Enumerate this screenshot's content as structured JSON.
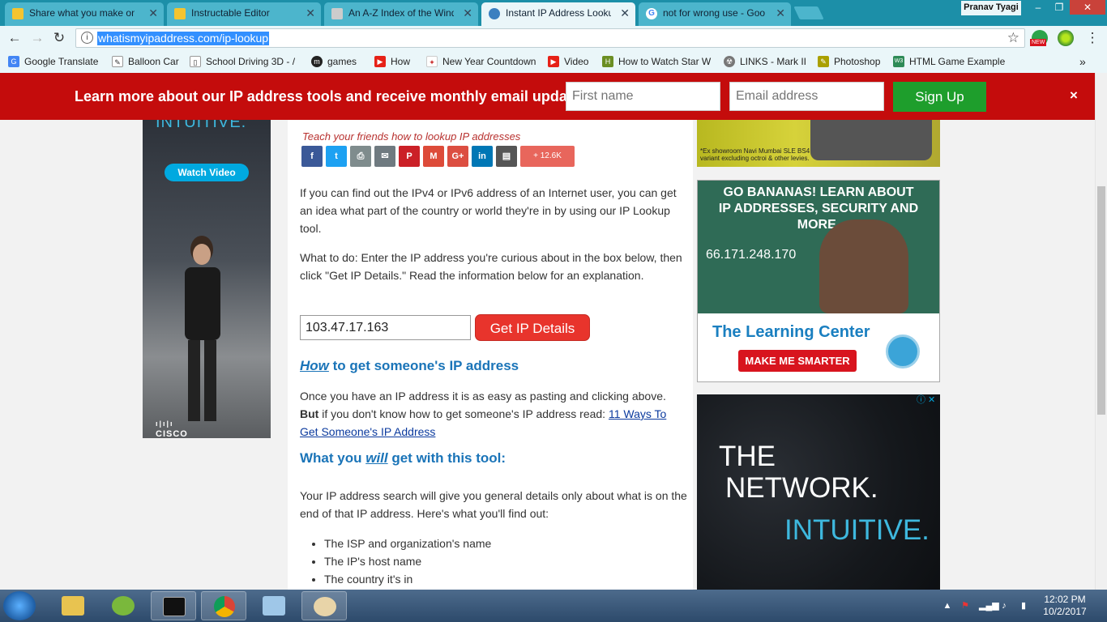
{
  "tabs": [
    {
      "label": "Share what you make on",
      "icon": "instructables-icon",
      "color": "#f4c430"
    },
    {
      "label": "Instructable Editor",
      "icon": "instructables-icon",
      "color": "#f4c430"
    },
    {
      "label": "An A-Z Index of the Wind",
      "icon": "page-icon",
      "color": "#cccccc"
    },
    {
      "label": "Instant IP Address Looku",
      "icon": "globe-icon",
      "color": "#3a7fc0"
    },
    {
      "label": "not for wrong use - Goo",
      "icon": "google-icon",
      "color": "#4285f4"
    }
  ],
  "user": "Pranav Tyagi",
  "window_controls": {
    "minimize": "–",
    "maximize": "❐",
    "close": "✕"
  },
  "address": {
    "url": "whatismyipaddress.com/ip-lookup"
  },
  "extension_badge": "NEW",
  "bookmarks": [
    {
      "label": "Google Translate",
      "color": "#4285f4",
      "glyph": "G"
    },
    {
      "label": "Balloon Car",
      "color": "#ffffff",
      "glyph": "✎"
    },
    {
      "label": "School Driving 3D - /",
      "color": "#ffffff",
      "glyph": "▯"
    },
    {
      "label": "games",
      "color": "#222222",
      "glyph": "m"
    },
    {
      "label": "How",
      "color": "#e62117",
      "glyph": "▶"
    },
    {
      "label": "New Year Countdown",
      "color": "#ffffff",
      "glyph": "✦"
    },
    {
      "label": "Video",
      "color": "#e62117",
      "glyph": "▶"
    },
    {
      "label": "How to Watch Star W",
      "color": "#6b8e23",
      "glyph": "H"
    },
    {
      "label": "LINKS - Mark II",
      "color": "#777777",
      "glyph": "☢"
    },
    {
      "label": "Photoshop",
      "color": "#aaa000",
      "glyph": "✎"
    },
    {
      "label": "HTML Game Example",
      "color": "#2e8b57",
      "glyph": "W3"
    }
  ],
  "bookmarks_more": "»",
  "banner": {
    "message": "Learn more about our IP address tools and receive monthly email updates",
    "first_name_placeholder": "First name",
    "email_placeholder": "Email address",
    "signup": "Sign Up",
    "close": "×"
  },
  "left_ad": {
    "tagline": "INTUITIVE.",
    "cta": "Watch Video",
    "brand": "CISCO"
  },
  "main": {
    "teach": "Teach your friends how to lookup IP addresses",
    "share_buttons": [
      {
        "name": "facebook",
        "glyph": "f",
        "color": "#3b5998"
      },
      {
        "name": "twitter",
        "glyph": "t",
        "color": "#1da1f2"
      },
      {
        "name": "print",
        "glyph": "⎙",
        "color": "#7f8c8d"
      },
      {
        "name": "email",
        "glyph": "✉",
        "color": "#6f7a80"
      },
      {
        "name": "pinterest",
        "glyph": "P",
        "color": "#cb2027"
      },
      {
        "name": "gmail",
        "glyph": "M",
        "color": "#dd4b39"
      },
      {
        "name": "google-plus",
        "glyph": "G+",
        "color": "#dc4e41"
      },
      {
        "name": "linkedin",
        "glyph": "in",
        "color": "#0077b5"
      },
      {
        "name": "printfriendly",
        "glyph": "▤",
        "color": "#555555"
      }
    ],
    "share_count": "+ 12.6K",
    "p1": "If you can find out the IPv4 or IPv6 address of an Internet user, you can get an idea what part of the country or world they're in by using our IP Lookup tool.",
    "p2": "What to do: Enter the IP address you're curious about in the box below, then click \"Get IP Details.\" Read the information below for an explanation.",
    "ip_value": "103.47.17.163",
    "get_button": "Get IP Details",
    "h_how_em": "How",
    "h_how_rest": " to get someone's IP address",
    "p3_a": "Once you have an IP address it is as easy as pasting and clicking above. ",
    "p3_bold": "But",
    "p3_b": " if you don't know how to get someone's IP address read: ",
    "p3_link": "11 Ways To Get Someone's IP Address",
    "h_what_a": "What you ",
    "h_what_em": "will",
    "h_what_b": " get with this tool:",
    "p4": "Your IP address search will give you general details only about what is on the end of that IP address. Here's what you'll find out:",
    "list": [
      "The ISP and organization's name",
      "The IP's host name",
      "The country it's in"
    ]
  },
  "right_ads": {
    "car_note": "*Ex showroom Navi Mumbai SLE BS4 variant excluding octroi & other levies.",
    "learn_head_1": "GO BANANAS!  LEARN ABOUT",
    "learn_head_2": "IP ADDRESSES, SECURITY AND MORE.",
    "learn_numbers": "66.171.248.170",
    "learn_center": "The Learning Center",
    "learn_cta": "MAKE ME SMARTER",
    "net_1": "THE",
    "net_2": "NETWORK.",
    "net_3": "INTUITIVE.",
    "ad_info": "ⓘ ✕"
  },
  "clock": {
    "time": "12:02 PM",
    "date": "10/2/2017"
  }
}
